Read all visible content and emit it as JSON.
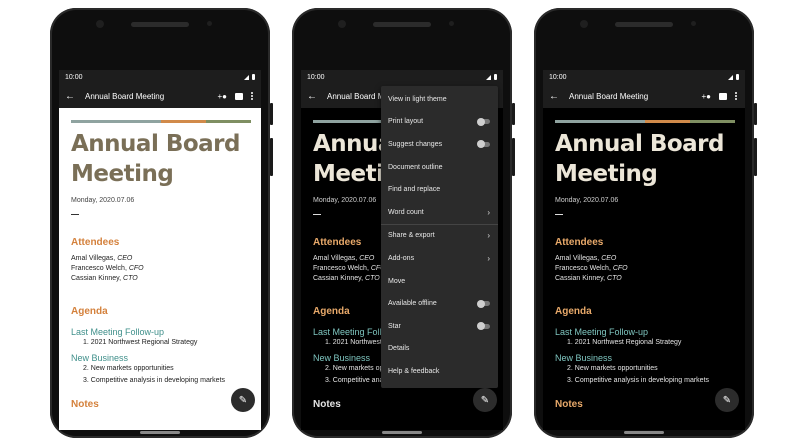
{
  "colors": {
    "bar1": "#8fa3a0",
    "bar2": "#d18a4a",
    "bar3": "#c0a46a",
    "bar4": "#7f8f62",
    "accent_orange": "#d4813c",
    "accent_teal": "#3f8f8a"
  },
  "status": {
    "time": "10:00"
  },
  "appbar": {
    "title": "Annual Board Meeting",
    "icons": [
      "back-arrow-icon",
      "add-person-icon",
      "comment-icon",
      "more-vert-icon"
    ]
  },
  "doc": {
    "title_line1": "Annual Board",
    "title_line2": "Meeting",
    "date": "Monday, 2020.07.06",
    "attendees_heading": "Attendees",
    "attendees": [
      {
        "name": "Amal Villegas,",
        "role": "CEO"
      },
      {
        "name": "Francesco Welch,",
        "role": "CFO"
      },
      {
        "name": "Cassian Kinney,",
        "role": "CTO"
      }
    ],
    "agenda_heading": "Agenda",
    "followup_heading": "Last Meeting Follow-up",
    "followup_items": [
      "1.  2021 Northwest Regional Strategy"
    ],
    "newbiz_heading": "New Business",
    "newbiz_items": [
      "2.  New markets opportunities",
      "3.  Competitive analysis in developing markets"
    ],
    "notes_heading": "Notes",
    "followup_short": "Last Meeting Follow-"
  },
  "menu": {
    "items": [
      {
        "label": "View in light theme"
      },
      {
        "label": "Print layout",
        "control": "toggle"
      },
      {
        "label": "Suggest changes",
        "control": "toggle"
      },
      {
        "label": "Document outline"
      },
      {
        "label": "Find and replace"
      },
      {
        "label": "Word count",
        "control": "chevron"
      },
      {
        "label": "Share & export",
        "control": "chevron"
      },
      {
        "label": "Add-ons",
        "control": "chevron"
      },
      {
        "label": "Move"
      },
      {
        "label": "Available offline",
        "control": "toggle"
      },
      {
        "label": "Star",
        "control": "toggle"
      },
      {
        "label": "Details"
      },
      {
        "label": "Help & feedback"
      }
    ]
  },
  "fab": {
    "icon": "edit-pencil-icon"
  }
}
